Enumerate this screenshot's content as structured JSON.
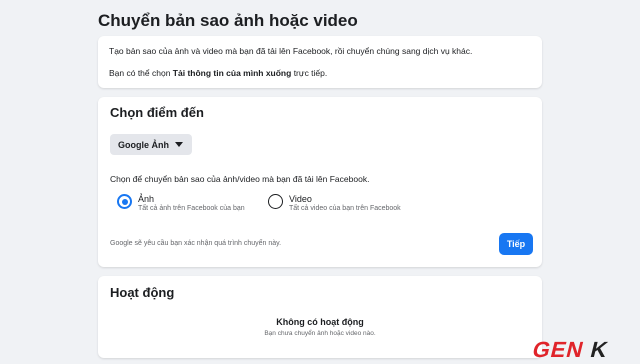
{
  "header": {
    "title": "Chuyển bản sao ảnh hoặc video"
  },
  "intro": {
    "line1": "Tạo bản sao của ảnh và video mà bạn đã tải lên Facebook, rồi chuyển chúng sang dịch vụ khác.",
    "line2_prefix": "Bạn có thể chọn ",
    "line2_link": "Tải thông tin của mình xuống",
    "line2_suffix": " trực tiếp."
  },
  "destination": {
    "title": "Chọn điểm đến",
    "selected_service": "Google Ảnh",
    "choose_text": "Chọn để chuyển bản sao của ảnh/video mà bạn đã tải lên Facebook.",
    "options": [
      {
        "label": "Ảnh",
        "description": "Tất cả ảnh trên Facebook của bạn",
        "checked": true
      },
      {
        "label": "Video",
        "description": "Tất cả video của bạn trên Facebook",
        "checked": false
      }
    ],
    "verify_note": "Google sẽ yêu cầu bạn xác nhận quá trình chuyển này.",
    "next_label": "Tiếp"
  },
  "activity": {
    "title": "Hoạt động",
    "empty_title": "Không có hoạt động",
    "empty_subtitle": "Bạn chưa chuyển ảnh hoặc video nào."
  },
  "watermark": {
    "text": "GENK"
  },
  "colors": {
    "accent": "#1877f2",
    "background": "#f0f2f5",
    "watermark_red": "#e0242a"
  }
}
